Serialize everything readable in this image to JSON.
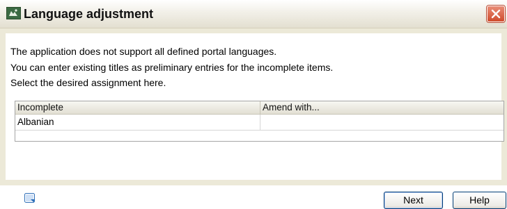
{
  "window": {
    "title": "Language adjustment"
  },
  "message": {
    "line1": "The application does not support all defined portal languages.",
    "line2": "You can enter existing titles as preliminary entries for the incomplete items.",
    "line3": "Select the desired assignment here."
  },
  "table": {
    "columns": [
      "Incomplete",
      "Amend with..."
    ],
    "rows": [
      [
        "Albanian",
        ""
      ]
    ]
  },
  "buttons": {
    "next": "Next",
    "help": "Help"
  },
  "icons": {
    "app": "application-icon",
    "close": "close-icon",
    "footer": "help-note-icon"
  }
}
